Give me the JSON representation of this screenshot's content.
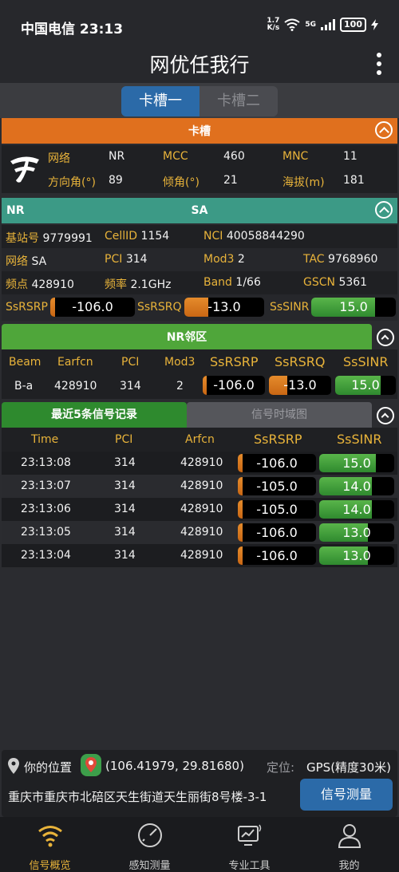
{
  "status_bar": {
    "carrier_time": "中国电信 23:13",
    "speed_top": "1.7",
    "speed_unit": "K/s",
    "net": "5G",
    "battery": "100"
  },
  "appbar": {
    "title": "网优任我行"
  },
  "sim_tabs": [
    {
      "label": "卡槽一",
      "active": true
    },
    {
      "label": "卡槽二",
      "active": false
    }
  ],
  "slot_section": {
    "title": "卡槽",
    "fields": {
      "network_label": "网络",
      "network_value": "NR",
      "mcc_label": "MCC",
      "mcc_value": "460",
      "mnc_label": "MNC",
      "mnc_value": "11",
      "azimuth_label": "方向角(°)",
      "azimuth_value": "89",
      "tilt_label": "倾角(°)",
      "tilt_value": "21",
      "altitude_label": "海拔(m)",
      "altitude_value": "181"
    }
  },
  "nr_section": {
    "left": "NR",
    "title": "SA",
    "gnb_label": "基站号",
    "gnb_value": "9779991",
    "cellid_label": "CellID",
    "cellid_value": "1154",
    "nci_label": "NCI",
    "nci_value": "40058844290",
    "net_label": "网络",
    "net_value": "SA",
    "pci_label": "PCI",
    "pci_value": "314",
    "mod3_label": "Mod3",
    "mod3_value": "2",
    "tac_label": "TAC",
    "tac_value": "9768960",
    "freq_point_label": "频点",
    "freq_point_value": "428910",
    "freq_label": "频率",
    "freq_value": "2.1GHz",
    "band_label": "Band",
    "band_value": "1/66",
    "gscn_label": "GSCN",
    "gscn_value": "5361",
    "rsrp_label": "SsRSRP",
    "rsrp_value": "-106.0",
    "rsrp_level": 0.06,
    "rsrq_label": "SsRSRQ",
    "rsrq_value": "-13.0",
    "rsrq_level": 0.3,
    "sinr_label": "SsSINR",
    "sinr_value": "15.0",
    "sinr_level": 0.75
  },
  "neighbor_section": {
    "title": "NR邻区",
    "headers": [
      "Beam",
      "Earfcn",
      "PCI",
      "Mod3",
      "SsRSRP",
      "SsRSRQ",
      "SsSINR"
    ],
    "row": {
      "beam": "B-a",
      "earfcn": "428910",
      "pci": "314",
      "mod3": "2",
      "rsrp": "-106.0",
      "rsrq": "-13.0",
      "sinr": "15.0",
      "rsrp_level": 0.06,
      "rsrq_level": 0.3,
      "sinr_level": 0.75
    }
  },
  "records_section": {
    "tab_active": "最近5条信号记录",
    "tab_inactive": "信号时域图",
    "headers": [
      "Time",
      "PCI",
      "Arfcn",
      "SsRSRP",
      "SsSINR"
    ],
    "rows": [
      {
        "time": "23:13:08",
        "pci": "314",
        "arfcn": "428910",
        "rsrp": "-106.0",
        "sinr": "15.0",
        "rsrp_level": 0.06,
        "sinr_level": 0.75
      },
      {
        "time": "23:13:07",
        "pci": "314",
        "arfcn": "428910",
        "rsrp": "-105.0",
        "sinr": "14.0",
        "rsrp_level": 0.06,
        "sinr_level": 0.7
      },
      {
        "time": "23:13:06",
        "pci": "314",
        "arfcn": "428910",
        "rsrp": "-105.0",
        "sinr": "14.0",
        "rsrp_level": 0.06,
        "sinr_level": 0.7
      },
      {
        "time": "23:13:05",
        "pci": "314",
        "arfcn": "428910",
        "rsrp": "-106.0",
        "sinr": "13.0",
        "rsrp_level": 0.06,
        "sinr_level": 0.65
      },
      {
        "time": "23:13:04",
        "pci": "314",
        "arfcn": "428910",
        "rsrp": "-106.0",
        "sinr": "13.0",
        "rsrp_level": 0.06,
        "sinr_level": 0.65
      }
    ]
  },
  "location": {
    "label": "你的位置",
    "coords": "(106.41979, 29.81680)",
    "mode_label": "定位:",
    "mode_value": "GPS(精度30米)",
    "address": "重庆市重庆市北碚区天生街道天生丽街8号楼-3-1",
    "button": "信号测量"
  },
  "nav": [
    {
      "label": "信号概览",
      "icon": "wifi-icon",
      "active": true
    },
    {
      "label": "感知测量",
      "icon": "gauge-icon",
      "active": false
    },
    {
      "label": "专业工具",
      "icon": "monitor-tools-icon",
      "active": false
    },
    {
      "label": "我的",
      "icon": "person-icon",
      "active": false
    }
  ],
  "colors": {
    "orange": "#e0701e",
    "teal": "#3c9a86",
    "green": "#4fa63a",
    "blue": "#2b6aa8",
    "yellow_label": "#e8b33a"
  }
}
